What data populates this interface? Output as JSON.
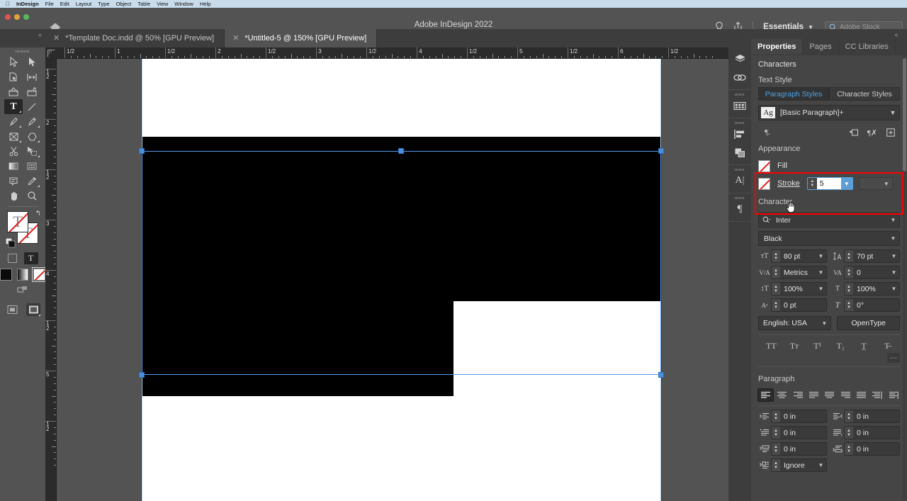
{
  "mac_menu": {
    "apple": "apple-logo",
    "items": [
      "InDesign",
      "File",
      "Edit",
      "Layout",
      "Type",
      "Object",
      "Table",
      "View",
      "Window",
      "Help"
    ]
  },
  "titlebar": {
    "title": "Adobe InDesign 2022",
    "home_icon": "home-icon",
    "bulb_icon": "lightbulb-icon",
    "share_icon": "share-icon",
    "workspace": "Essentials",
    "stock_placeholder": "Adobe Stock"
  },
  "tabs": [
    {
      "label": "*Template Doc.indd @ 50% [GPU Preview]",
      "active": false
    },
    {
      "label": "*Untitled-5 @ 150% [GPU Preview]",
      "active": true
    }
  ],
  "toolbar": {
    "tools": [
      {
        "name": "selection-tool",
        "glyph": "arrow-outline",
        "selected": false,
        "menu": false
      },
      {
        "name": "direct-selection-tool",
        "glyph": "arrow-solid",
        "selected": false,
        "menu": false
      },
      {
        "name": "page-tool",
        "glyph": "page",
        "selected": false,
        "menu": false
      },
      {
        "name": "gap-tool",
        "glyph": "gap",
        "selected": false,
        "menu": false
      },
      {
        "name": "content-collector-tool",
        "glyph": "collector",
        "selected": false,
        "menu": false
      },
      {
        "name": "content-placer-tool",
        "glyph": "placer",
        "selected": false,
        "menu": false
      },
      {
        "name": "type-tool",
        "glyph": "type-T",
        "selected": true,
        "menu": true
      },
      {
        "name": "line-tool",
        "glyph": "line",
        "selected": false,
        "menu": false
      },
      {
        "name": "pen-tool",
        "glyph": "pen",
        "selected": false,
        "menu": true
      },
      {
        "name": "pencil-tool",
        "glyph": "pencil",
        "selected": false,
        "menu": true
      },
      {
        "name": "rectangle-frame-tool",
        "glyph": "frame-x",
        "selected": false,
        "menu": true
      },
      {
        "name": "polygon-tool",
        "glyph": "polygon",
        "selected": false,
        "menu": true
      },
      {
        "name": "scissors-tool",
        "glyph": "scissors",
        "selected": false,
        "menu": false
      },
      {
        "name": "free-transform-tool",
        "glyph": "transform",
        "selected": false,
        "menu": true
      },
      {
        "name": "gradient-swatch-tool",
        "glyph": "gradient",
        "selected": false,
        "menu": false
      },
      {
        "name": "gradient-feather-tool",
        "glyph": "feather",
        "selected": false,
        "menu": false
      },
      {
        "name": "note-tool",
        "glyph": "note",
        "selected": false,
        "menu": false
      },
      {
        "name": "eyedropper-tool",
        "glyph": "eyedropper",
        "selected": false,
        "menu": true
      },
      {
        "name": "hand-tool",
        "glyph": "hand",
        "selected": false,
        "menu": false
      },
      {
        "name": "zoom-tool",
        "glyph": "magnifier",
        "selected": false,
        "menu": false
      }
    ],
    "fill_stroke": {
      "fill": "none-swatch",
      "stroke": "none-swatch",
      "swap_icon": "swap-arrows-icon",
      "default_icon": "default-colors-icon"
    },
    "format_affects": {
      "container": "format-container-icon",
      "text": "format-text-icon"
    },
    "apply": [
      {
        "name": "apply-color",
        "type": "black"
      },
      {
        "name": "apply-gradient",
        "type": "gradient"
      },
      {
        "name": "apply-none",
        "type": "none",
        "selected": true
      }
    ],
    "screen_modes": [
      {
        "name": "normal-mode",
        "selected": false
      },
      {
        "name": "preview-mode",
        "selected": true
      }
    ]
  },
  "rulers": {
    "unit": "inches",
    "horizontal_labels": [
      "1/2",
      "1",
      "1/2",
      "2",
      "1/2",
      "3",
      "1/2",
      "4",
      "1/2",
      "5",
      "1/2",
      "6",
      "1/2"
    ],
    "vertical_labels": [
      "1/2",
      "2",
      "1/2",
      "3",
      "4",
      "1/2",
      "5",
      "1/2"
    ]
  },
  "canvas": {
    "selection_color": "#4a90e2",
    "shape_fill": "#000000",
    "shape_name": "black-L-shape"
  },
  "icon_dock": {
    "items": [
      {
        "name": "layers-panel-icon",
        "label": "Layers"
      },
      {
        "name": "links-panel-icon",
        "label": "Links"
      },
      {
        "name": "swatches-panel-icon",
        "label": "Swatches"
      },
      {
        "name": "align-panel-icon",
        "label": "Align"
      },
      {
        "name": "pathfinder-panel-icon",
        "label": "Pathfinder"
      },
      {
        "name": "text-frame-options-icon",
        "label": "Text Frame"
      },
      {
        "name": "paragraph-panel-icon",
        "label": "Paragraph"
      }
    ]
  },
  "panel": {
    "tabs": [
      {
        "label": "Properties",
        "active": true
      },
      {
        "label": "Pages",
        "active": false
      },
      {
        "label": "CC Libraries",
        "active": false
      }
    ],
    "context_label": "Characters",
    "text_style": {
      "title": "Text Style",
      "paragraph_styles_label": "Paragraph Styles",
      "character_styles_label": "Character Styles",
      "active_style_tab": "Paragraph Styles",
      "style_preview": "Ag",
      "style_value": "[Basic Paragraph]+",
      "icons": [
        "paragraph-style-options-icon",
        "new-style-icon",
        "clear-overrides-icon",
        "new-paragraph-style-icon"
      ]
    },
    "appearance": {
      "title": "Appearance",
      "highlighted": true,
      "highlight_color": "#ff0000",
      "fill_label": "Fill",
      "fill_swatch": "none-swatch",
      "stroke_label": "Stroke",
      "stroke_swatch": "none-swatch",
      "stroke_label_hovered": true,
      "stroke_weight": "5",
      "stroke_style": "",
      "cursor": "pointing-hand-cursor"
    },
    "character": {
      "title": "Character",
      "font_family": "Inter",
      "font_style": "Black",
      "font_size": "80 pt",
      "leading": "70 pt",
      "kerning": "Metrics",
      "tracking": "0",
      "vertical_scale": "100%",
      "horizontal_scale": "100%",
      "baseline_shift": "0 pt",
      "skew": "0°",
      "language": "English: USA",
      "opentype_label": "OpenType",
      "style_buttons": [
        {
          "name": "all-caps-button",
          "glyph": "TT"
        },
        {
          "name": "small-caps-button",
          "glyph": "Tᴛ"
        },
        {
          "name": "superscript-button",
          "glyph": "T¹"
        },
        {
          "name": "subscript-button",
          "glyph": "T₁"
        },
        {
          "name": "underline-button",
          "glyph": "T̲"
        },
        {
          "name": "strikethrough-button",
          "glyph": "T̶"
        }
      ],
      "more_options": "more-options-icon"
    },
    "paragraph": {
      "title": "Paragraph",
      "align_buttons": [
        {
          "name": "align-left-button",
          "active": true
        },
        {
          "name": "align-center-button",
          "active": false
        },
        {
          "name": "align-right-button",
          "active": false
        },
        {
          "name": "justify-last-left-button",
          "active": false
        },
        {
          "name": "justify-last-center-button",
          "active": false
        },
        {
          "name": "justify-last-right-button",
          "active": false
        },
        {
          "name": "justify-all-button",
          "active": false
        },
        {
          "name": "align-toward-spine-button",
          "active": false
        },
        {
          "name": "align-away-spine-button",
          "active": false
        }
      ],
      "left_indent": "0 in",
      "right_indent": "0 in",
      "first_line_indent": "0 in",
      "last_line_indent": "0 in",
      "space_before": "0 in",
      "space_after": "0 in",
      "drop_cap": "Ignore"
    }
  }
}
